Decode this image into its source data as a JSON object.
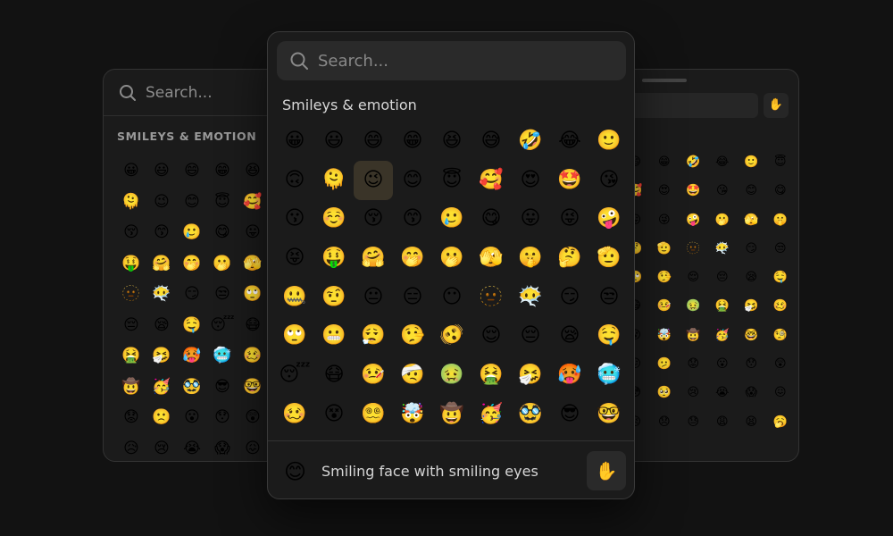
{
  "left_panel": {
    "search_placeholder": "Search...",
    "section_title": "SMILEYS & EMOTION",
    "emojis": [
      "😀",
      "😃",
      "😄",
      "😁",
      "😆",
      "😅",
      "🤣",
      "😂",
      "🫠",
      "😉",
      "😊",
      "😇",
      "🥰",
      "😍",
      "🤩",
      "😘",
      "😚",
      "😙",
      "🥲",
      "😋",
      "😛",
      "😜",
      "🤪",
      "😝",
      "🤑",
      "🤗",
      "🤭",
      "🫢",
      "🫣",
      "🤫",
      "🤔",
      "🫡",
      "🫥",
      "😶‍🌫️",
      "😏",
      "😒",
      "🙄",
      "😬",
      "😮‍💨",
      "🤥",
      "😔",
      "😪",
      "🤤",
      "😴",
      "😷",
      "🤒",
      "🤕",
      "🤢",
      "🤮",
      "🤧",
      "🥵",
      "🥶",
      "🥴",
      "😵",
      "😵‍💫",
      "🤯",
      "🤠",
      "🥳",
      "🥸",
      "😎",
      "🤓",
      "🧐",
      "😕",
      "🫤",
      "😟",
      "🙁",
      "😮",
      "😯",
      "😲",
      "😳",
      "🥺",
      "🥹",
      "😥",
      "😢",
      "😭",
      "😱",
      "😖",
      "😣",
      "😞",
      "😓"
    ]
  },
  "right_panel": {
    "hand_icon": "✋",
    "emojis": [
      "😄",
      "😁",
      "🤣",
      "😂",
      "🙂",
      "😇",
      "🥰",
      "😍",
      "🤩",
      "😘",
      "😊",
      "😋",
      "😛",
      "😜",
      "🤪",
      "🫢",
      "🫣",
      "🤫",
      "🤔",
      "🫡",
      "🫥",
      "😶‍🌫️",
      "😏",
      "😒",
      "🙄",
      "🤥",
      "😌",
      "😔",
      "😪",
      "🤤",
      "😷",
      "🤒",
      "🤢",
      "🤮",
      "🤧",
      "🥴",
      "😵",
      "🤯",
      "🤠",
      "🥳",
      "🤓",
      "🧐",
      "😕",
      "🫤",
      "😟",
      "😮",
      "😯",
      "😲",
      "😳",
      "🥺",
      "😢",
      "😭",
      "😱",
      "😖",
      "😣",
      "😞",
      "😓",
      "😩",
      "😫",
      "🥱"
    ]
  },
  "center_panel": {
    "search_placeholder": "Search...",
    "section_title": "Smileys & emotion",
    "selected_index": 11,
    "emojis": [
      "😀",
      "😃",
      "😄",
      "😁",
      "😆",
      "😅",
      "🤣",
      "😂",
      "🙂",
      "🙃",
      "🫠",
      "😉",
      "😊",
      "😇",
      "🥰",
      "😍",
      "🤩",
      "😘",
      "😗",
      "☺️",
      "😚",
      "😙",
      "🥲",
      "😋",
      "😛",
      "😜",
      "🤪",
      "😝",
      "🤑",
      "🤗",
      "🤭",
      "🫢",
      "🫣",
      "🤫",
      "🤔",
      "🫡",
      "🤐",
      "🤨",
      "😐",
      "😑",
      "😶",
      "🫥",
      "😶‍🌫️",
      "😏",
      "😒",
      "🙄",
      "😬",
      "😮‍💨",
      "🤥",
      "🫨",
      "😌",
      "😔",
      "😪",
      "🤤",
      "😴",
      "😷",
      "🤒",
      "🤕",
      "🤢",
      "🤮",
      "🤧",
      "🥵",
      "🥶",
      "🥴",
      "😵",
      "😵‍💫",
      "🤯",
      "🤠",
      "🥳",
      "🥸",
      "😎",
      "🤓"
    ],
    "footer": {
      "emoji": "😊",
      "label": "Smiling face with smiling eyes",
      "tone_button": "✋"
    }
  },
  "icons": {
    "search": "search-icon",
    "hand": "raised-hand-icon"
  }
}
